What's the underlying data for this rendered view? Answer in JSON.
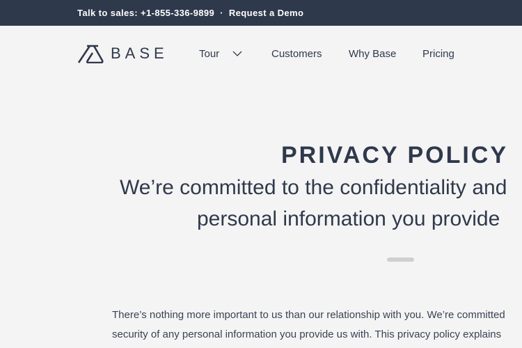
{
  "topbar": {
    "sales": "Talk to sales: +1-855-336-9899",
    "separator": "·",
    "demo": "Request a Demo"
  },
  "nav": {
    "logo": "BASE",
    "items": [
      {
        "label": "Tour"
      },
      {
        "label": "Customers"
      },
      {
        "label": "Why Base"
      },
      {
        "label": "Pricing"
      }
    ]
  },
  "hero": {
    "title": "PRIVACY POLICY",
    "subtitle_line1": "We’re committed to the confidentiality and",
    "subtitle_line2": "personal information you provide"
  },
  "body": {
    "line1": "There’s nothing more important to us than our relationship with you. We’re committed",
    "line2": "security of any personal information you provide us with. This privacy policy explains"
  }
}
